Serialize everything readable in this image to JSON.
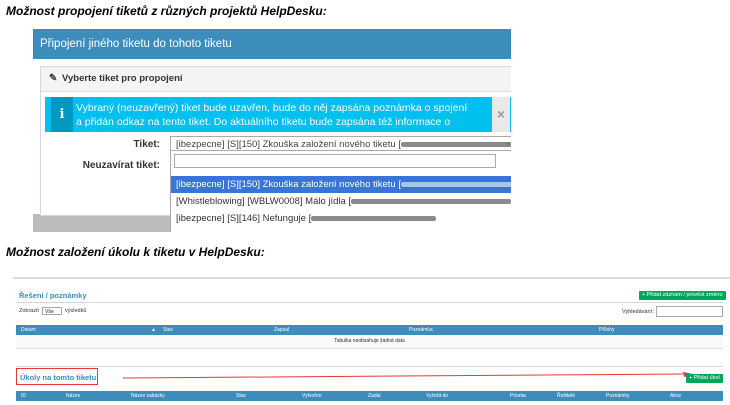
{
  "captions": {
    "top": "Možnost propojení tiketů z různých projektů HelpDesku:",
    "bottom": "Možnost založení úkolu k tiketu v HelpDesku:"
  },
  "link_dialog": {
    "title": "Připojení jiného tiketu do tohoto tiketu",
    "panel_title": "Vyberte tiket pro propojení",
    "info_text": "Vybraný (neuzavřený) tiket bude uzavřen, bude do něj zapsána poznámka o spojení a přidán odkaz na tento tiket. Do aktuálního tiketu bude zapsána též informace o spojení.",
    "info_icon": "i",
    "close_icon": "×",
    "ticket_label": "Tiket:",
    "close_label": "Neuzavírat tiket:",
    "selected_value": "[ibezpecne] [S][150] Zkouška založení nového tiketu [",
    "options": [
      "[ibezpecne] [S][150] Zkouška založení nového tiketu [",
      "[Whistleblowing] [WBLW0008] Málo jídla [",
      "[ibezpecne] [S][146] Nefunguje ["
    ]
  },
  "helpdesk": {
    "notes_title": "Řešení / poznámky",
    "add_note_button": "+ Přidat záznam / provést změnu",
    "show_label": "Zobrazit",
    "show_value": "Vše",
    "results_label": "výsledků",
    "search_label": "Vyhledávání:",
    "notes_columns": [
      "Datum",
      "Stav",
      "Zapsal",
      "Poznámka",
      "Přílohy"
    ],
    "empty_text": "Tabulka neobsahuje žádná data",
    "tasks_title": "Úkoly na tomto tiketu",
    "add_task_button": "+ Přidat úkol",
    "tasks_columns": [
      "ID",
      "Název",
      "Název zakázky",
      "Stav",
      "Vytvořen",
      "Zadal",
      "Vyřešit do",
      "Priorita",
      "Řešitelé",
      "Poznámky",
      "Akce"
    ]
  },
  "colors": {
    "header_blue": "#3c8dbc",
    "info_cyan": "#00c0ef",
    "select_blue": "#3875d7",
    "button_green": "#00a65a",
    "highlight_red": "#e53935"
  }
}
